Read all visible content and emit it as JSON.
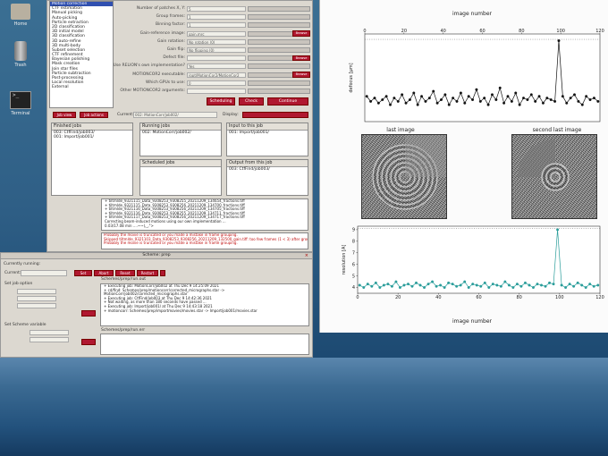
{
  "desktop": {
    "icons": [
      {
        "label": "Home",
        "glyph": "home-folder-icon"
      },
      {
        "label": "Trash",
        "glyph": "trash-icon"
      },
      {
        "label": "Terminal",
        "glyph": "terminal-icon",
        "glyph_text": ">_"
      }
    ]
  },
  "relion": {
    "jobtypes": [
      "Motion correction",
      "CTF estimation",
      "Manual picking",
      "Auto-picking",
      "Particle extraction",
      "2D classification",
      "3D initial model",
      "3D classification",
      "3D auto-refine",
      "3D multi-body",
      "Subset selection",
      "CTF refinement",
      "Bayesian polishing",
      "Mask creation",
      "Join star files",
      "Particle subtraction",
      "Post-processing",
      "Local resolution",
      "External"
    ],
    "selected_jobtype": 0,
    "params": [
      {
        "label": "Number of patches X, Y:",
        "value": "5"
      },
      {
        "label": "Group frames:",
        "value": "1"
      },
      {
        "label": "Binning factor:",
        "value": "1"
      },
      {
        "label": "Gain-reference image:",
        "value": "gain.mrc"
      },
      {
        "label": "Gain rotation:",
        "value": "No rotation (0)"
      },
      {
        "label": "Gain flip:",
        "value": "No flipping (0)"
      },
      {
        "label": "Defect file:",
        "value": ""
      },
      {
        "label": "Use RELION's own implementation?",
        "value": "Yes"
      },
      {
        "label": "MOTIONCOR2 executable:",
        "value": "/opt/MotionCor2/MotionCor2"
      },
      {
        "label": "Which GPUs to use:",
        "value": "0"
      },
      {
        "label": "Other MOTIONCOR2 arguments:",
        "value": ""
      }
    ],
    "browse_label": "Browse",
    "scheduling_label": "Scheduling",
    "check_label": "Check",
    "continue_label": "Continue",
    "job_view_label": "Job view",
    "job_actions_label": "Job actions",
    "current_label": "Current:",
    "current_value": "002: MotionCorr/job002/",
    "display_label": "Display:",
    "finished_jobs": {
      "header": "Finished jobs",
      "items": [
        "003: CtfFind/job003/",
        "001: Import/job001/"
      ]
    },
    "running_jobs": {
      "header": "Running jobs",
      "items": [
        "002: MotionCorr/job002/"
      ]
    },
    "scheduled_jobs": {
      "header": "Scheduled jobs",
      "items": []
    },
    "input_jobs": {
      "header": "Input to this job",
      "items": [
        "001: Import/job001/"
      ]
    },
    "output_jobs": {
      "header": "Output from this job",
      "items": [
        "003: CtfFind/job003/"
      ]
    },
    "log_lines": [
      "+ tiltmlde_9321115_Data_9308253_9308255_20211209_134654_fractions.tiff",
      "+ tiltmlde_9321115_Data_9308253_9308256_20211209_134700_fractions.tiff",
      "+ tiltmlde_9321116_Data_9308253_9308256_20211209_134705_fractions.tiff",
      "+ tiltmlde_9321116_Data_9308253_9308255_20211209_134711_fractions.tiff",
      "+ tiltmlde_9321117_Data_9308253_9308256_20211209_134717_fractions.tiff",
      "Correcting beam-induced motions using our own implementation ...",
      "0.03/17.08 min ....~~(,_,\">"
    ],
    "error_lines": [
      "Probably the movie is truncated or you made a mistake in frame grouping.",
      "Skipped tiltmlde_9321103_Data_9308253_9308256_20211209_132500_gain.tiff: too few frames (1 < 3) after grouping.",
      "Probably the movie is truncated or you made a mistake in frame grouping."
    ]
  },
  "scheme": {
    "title": "Scheme: prep",
    "currently_running_label": "Currently running:",
    "current_label": "Current:",
    "buttons": [
      "Set",
      "Abort",
      "Reset",
      "Restart"
    ],
    "set_job_option_label": "Set job option",
    "set_scheme_variable_label": "Set Scheme variable",
    "log_header": "Schemes/prep/run.out",
    "log_lines": [
      "+ Executing job: MotionCorr/job002 at Thu Dec  9 14:25:09 2021",
      "+ cd/find: Schemes/prep/motioncorr/corrected_micrographs.star ->",
      "MotionCorr/job002/corrected_micrographs.star",
      "+ Executing job: CtfFind/job003 at Thu Dec  9 14:42:36 2021",
      "+ Not waiting, as more than 180 seconds have passed ...",
      "+ Executing job: Import/job001/ at Thu Dec  9 14:43:18 2021",
      "+ motioncorr: Schemes/prep/importmovies/movies.star -> Import/job001/movies.star"
    ],
    "err_header": "Schemes/prep/run.err"
  },
  "plots": {
    "top_title": "image number",
    "top_xticks": [
      "0",
      "20",
      "40",
      "60",
      "80",
      "100",
      "120"
    ],
    "top_ylabel": "defocus [µm]",
    "last_image_title": "last image",
    "second_last_image_title": "second last image",
    "bottom_xlabel": "image number",
    "bottom_xticks": [
      "0",
      "20",
      "40",
      "60",
      "80",
      "100",
      "120"
    ],
    "bottom_yticks": [
      "4",
      "5",
      "6",
      "7",
      "8",
      "9"
    ],
    "bottom_ylabel": "resolution [A]",
    "line_color_top": "#111111",
    "line_color_bottom": "#2a9d9a"
  },
  "chart_data": [
    {
      "type": "line",
      "title": "",
      "xlabel": "image number",
      "ylabel": "defocus [µm]",
      "xlim": [
        0,
        120
      ],
      "x": [
        1,
        3,
        5,
        7,
        9,
        11,
        13,
        15,
        17,
        19,
        21,
        23,
        25,
        27,
        29,
        31,
        33,
        35,
        37,
        39,
        41,
        43,
        45,
        47,
        49,
        51,
        53,
        55,
        57,
        59,
        61,
        63,
        65,
        67,
        69,
        71,
        73,
        75,
        77,
        79,
        81,
        83,
        85,
        87,
        89,
        91,
        93,
        95,
        97,
        99,
        101,
        103,
        105,
        107,
        109,
        111,
        113,
        115,
        117,
        119
      ],
      "y": [
        1.5,
        1.2,
        1.4,
        1.1,
        1.3,
        1.5,
        1.0,
        1.4,
        1.2,
        1.6,
        1.1,
        1.3,
        1.7,
        1.0,
        1.5,
        1.2,
        1.4,
        1.8,
        1.1,
        1.3,
        1.6,
        1.0,
        1.4,
        1.2,
        1.7,
        1.1,
        1.5,
        1.3,
        1.9,
        1.2,
        1.4,
        1.0,
        1.6,
        1.3,
        2.0,
        1.1,
        1.5,
        1.2,
        1.7,
        1.0,
        1.4,
        1.3,
        1.6,
        1.2,
        1.5,
        1.1,
        1.4,
        1.3,
        1.2,
        4.8,
        1.5,
        1.1,
        1.4,
        1.6,
        1.2,
        1.0,
        1.5,
        1.3,
        1.4,
        1.2
      ],
      "ylim": [
        0,
        5.2
      ]
    },
    {
      "type": "line",
      "title": "",
      "xlabel": "image number",
      "ylabel": "resolution [A]",
      "xlim": [
        0,
        120
      ],
      "ylim": [
        3.5,
        9.3
      ],
      "x": [
        1,
        3,
        5,
        7,
        9,
        11,
        13,
        15,
        17,
        19,
        21,
        23,
        25,
        27,
        29,
        31,
        33,
        35,
        37,
        39,
        41,
        43,
        45,
        47,
        49,
        51,
        53,
        55,
        57,
        59,
        61,
        63,
        65,
        67,
        69,
        71,
        73,
        75,
        77,
        79,
        81,
        83,
        85,
        87,
        89,
        91,
        93,
        95,
        97,
        99,
        101,
        103,
        105,
        107,
        109,
        111,
        113,
        115,
        117,
        119
      ],
      "y": [
        4.2,
        4.0,
        4.3,
        4.1,
        4.4,
        4.0,
        4.2,
        4.3,
        4.1,
        4.5,
        4.0,
        4.2,
        4.3,
        4.1,
        4.4,
        4.2,
        4.0,
        4.3,
        4.5,
        4.1,
        4.2,
        4.0,
        4.4,
        4.3,
        4.1,
        4.2,
        4.5,
        4.0,
        4.3,
        4.2,
        4.1,
        4.4,
        4.0,
        4.3,
        4.2,
        4.1,
        4.5,
        4.2,
        4.0,
        4.3,
        4.1,
        4.4,
        4.2,
        4.0,
        4.3,
        4.2,
        4.1,
        4.4,
        4.3,
        9.0,
        4.2,
        4.0,
        4.3,
        4.1,
        4.4,
        4.2,
        4.0,
        4.3,
        4.1,
        4.2
      ]
    }
  ]
}
